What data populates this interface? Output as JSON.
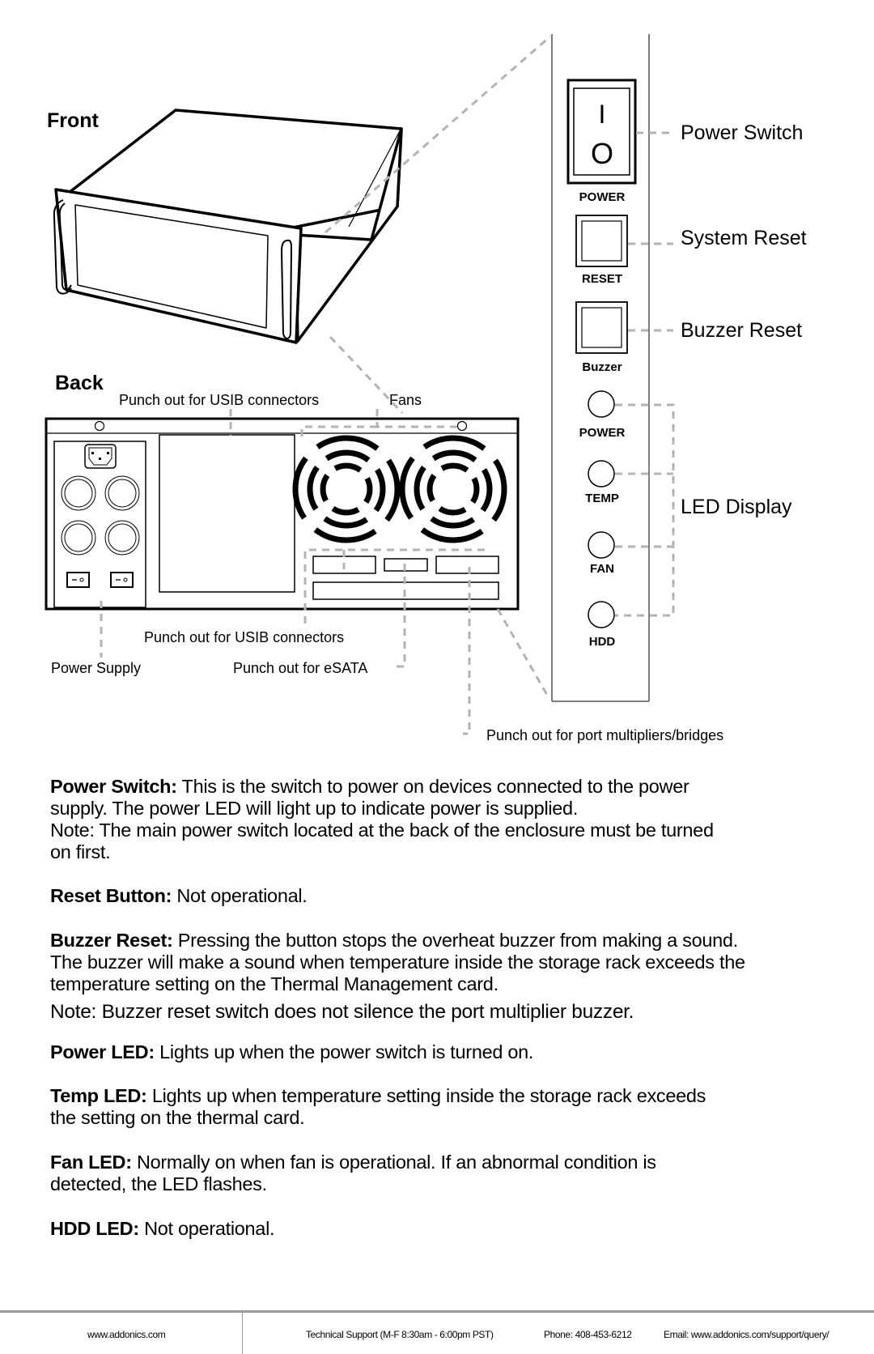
{
  "diagram": {
    "front_heading": "Front",
    "back_heading": "Back",
    "panel": {
      "switch_symbols": {
        "on": "I",
        "off": "O"
      },
      "button_labels": [
        "POWER",
        "RESET",
        "Buzzer"
      ],
      "led_labels": [
        "POWER",
        "TEMP",
        "FAN",
        "HDD"
      ]
    },
    "callouts": {
      "power_switch": "Power Switch",
      "system_reset": "System Reset",
      "buzzer_reset": "Buzzer Reset",
      "led_display": "LED Display",
      "usib_top": "Punch out for USIB connectors",
      "fans": "Fans",
      "usib_bottom": "Punch out for USIB connectors",
      "power_supply": "Power Supply",
      "esata": "Punch out for eSATA",
      "port_multipliers": "Punch out for port multipliers/bridges"
    }
  },
  "descriptions": [
    {
      "term": "Power Switch:",
      "lines": [
        "This is the switch to power on devices connected to the power",
        "supply. The power LED will light up to indicate power is supplied.",
        "Note: The main power switch located at the back of the enclosure must be turned",
        "on first."
      ]
    },
    {
      "term": "Reset Button:",
      "lines": [
        "Not operational."
      ]
    },
    {
      "term": "Buzzer Reset:",
      "lines": [
        "Pressing the button stops the overheat buzzer from making a sound.",
        "The buzzer will make a sound when temperature inside the storage rack exceeds the",
        "temperature setting on the Thermal Management card."
      ]
    },
    {
      "term": "",
      "lines": [
        "Note: Buzzer reset switch does not silence the port multiplier buzzer."
      ]
    },
    {
      "term": "Power LED:",
      "lines": [
        "Lights up when the power switch is turned on."
      ]
    },
    {
      "term": "Temp LED:",
      "lines": [
        "Lights up when temperature setting inside the storage rack exceeds",
        "the setting on the thermal card."
      ]
    },
    {
      "term": "Fan LED:",
      "lines": [
        "Normally on when fan is operational. If an abnormal condition is",
        "detected, the LED flashes."
      ]
    },
    {
      "term": "HDD LED:",
      "lines": [
        "Not operational."
      ]
    }
  ],
  "footer": {
    "website": "www.addonics.com",
    "support_hours": "Technical Support (M-F 8:30am - 6:00pm PST)",
    "phone": "Phone: 408-453-6212",
    "email": "Email: www.addonics.com/support/query/"
  }
}
